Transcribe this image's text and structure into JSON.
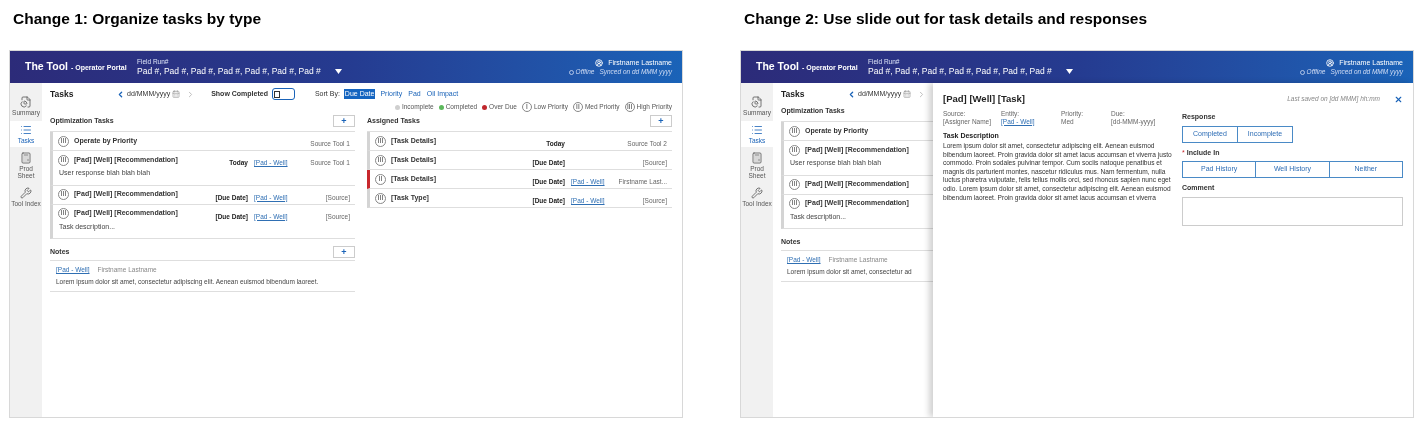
{
  "changes": [
    {
      "heading": "Change 1: Organize tasks by type",
      "header": {
        "brand": "The Tool",
        "subtitle": "- Operator Portal",
        "field_label": "Field Run#",
        "field_value": "Pad #, Pad #, Pad #, Pad #, Pad #, Pad #, Pad #",
        "user": "Firstname Lastname",
        "status": "Offline",
        "synced": "Synced on dd MMM yyyy"
      },
      "sidebar": [
        {
          "label": "Summary",
          "kind": "summary",
          "selected": false
        },
        {
          "label": "Tasks",
          "kind": "tasks",
          "selected": true
        },
        {
          "label": "Prod Sheet",
          "kind": "sheet",
          "selected": false
        },
        {
          "label": "Tool Index",
          "kind": "tools",
          "selected": false
        }
      ],
      "toolbar": {
        "title": "Tasks",
        "date": "dd/MMM/yyyy",
        "show_completed": {
          "label": "Show Completed",
          "on": false
        },
        "sort_label": "Sort By:",
        "sort_options": [
          {
            "label": "Due Date",
            "selected": true
          },
          {
            "label": "Priority",
            "selected": false
          },
          {
            "label": "Pad",
            "selected": false
          },
          {
            "label": "Oil Impact",
            "selected": false
          }
        ],
        "status_legend": [
          {
            "label": "Incomplete",
            "color": "#cfcfcf"
          },
          {
            "label": "Completed",
            "color": "#5cb85c"
          },
          {
            "label": "Over Due",
            "color": "#c0272d"
          }
        ],
        "priority_legend": [
          {
            "mark": "I",
            "label": "Low Priority"
          },
          {
            "mark": "II",
            "label": "Med Priority"
          },
          {
            "mark": "III",
            "label": "High Priority"
          }
        ]
      },
      "sections": [
        {
          "title": "Optimization Tasks",
          "add": "+",
          "tasks": [
            {
              "priority": "III",
              "title": "Operate by Priority",
              "source": "Source Tool 1",
              "overdue": false
            },
            {
              "priority": "III",
              "title": "[Pad] [Well] [Recommendation]",
              "due": "Today",
              "link": "[Pad - Well]",
              "source": "Source Tool 1",
              "detail": "User response blah blah blah",
              "overdue": false
            },
            {
              "priority": "III",
              "title": "[Pad] [Well] [Recommendation]",
              "due": "[Due Date]",
              "link": "[Pad - Well]",
              "source": "[Source]",
              "overdue": false
            },
            {
              "priority": "III",
              "title": "[Pad] [Well] [Recommendation]",
              "due": "[Due Date]",
              "link": "[Pad - Well]",
              "source": "[Source]",
              "detail": "Task description...",
              "overdue": false
            }
          ]
        },
        {
          "title": "Assigned Tasks",
          "add": "+",
          "tasks": [
            {
              "priority": "III",
              "title": "[Task Details]",
              "due": "Today",
              "source": "Source Tool 2",
              "overdue": false
            },
            {
              "priority": "III",
              "title": "[Task Details]",
              "due": "[Due Date]",
              "source": "[Source]",
              "overdue": false
            },
            {
              "priority": "II",
              "title": "[Task Details]",
              "due": "[Due Date]",
              "link": "[Pad - Well]",
              "source": "Firstname Last...",
              "overdue": true
            },
            {
              "priority": "III",
              "title": "[Task Type]",
              "due": "[Due Date]",
              "link": "[Pad - Well]",
              "source": "[Source]",
              "overdue": false
            }
          ]
        }
      ],
      "notes": {
        "title": "Notes",
        "add": "+",
        "items": [
          {
            "link": "[Pad - Well]",
            "author": "Firstname Lastname",
            "text": "Lorem ipsum dolor sit amet, consectetur adipiscing elit. Aenean euismod bibendum laoreet."
          }
        ]
      }
    },
    {
      "heading": "Change 2: Use slide out for task details and responses",
      "header": {
        "brand": "The Tool",
        "subtitle": "- Operator Portal",
        "field_label": "Field Run#",
        "field_value": "Pad #, Pad #, Pad #, Pad #, Pad #, Pad #, Pad #",
        "user": "Firstname Lastname",
        "status": "Offline",
        "synced": "Synced on dd MMM yyyy"
      },
      "sidebar": [
        {
          "label": "Summary",
          "kind": "summary",
          "selected": false
        },
        {
          "label": "Tasks",
          "kind": "tasks",
          "selected": true
        },
        {
          "label": "Prod Sheet",
          "kind": "sheet",
          "selected": false
        },
        {
          "label": "Tool Index",
          "kind": "tools",
          "selected": false
        }
      ],
      "toolbar": {
        "title": "Tasks",
        "date": "dd/MMM/yyyy"
      },
      "sections": [
        {
          "title": "Optimization Tasks",
          "tasks": [
            {
              "priority": "III",
              "title": "Operate by Priority",
              "overdue": false
            },
            {
              "priority": "III",
              "title": "[Pad] [Well] [Recommendation]",
              "detail": "User response blah blah blah",
              "overdue": false
            },
            {
              "priority": "III",
              "title": "[Pad] [Well] [Recommendation]",
              "overdue": false
            },
            {
              "priority": "III",
              "title": "[Pad] [Well] [Recommendation]",
              "detail": "Task description...",
              "overdue": false
            }
          ]
        }
      ],
      "notes": {
        "title": "Notes",
        "items": [
          {
            "link": "[Pad - Well]",
            "author": "Firstname Lastname",
            "text": "Lorem ipsum dolor sit amet, consectetur ad"
          }
        ]
      },
      "slideout": {
        "title": "[Pad] [Well] [Task]",
        "saved": "Last saved on [dd MMM] hh:mm",
        "fields": [
          {
            "label": "Source:",
            "value": "[Assigner Name]",
            "kind": "text"
          },
          {
            "label": "Entity:",
            "value": "[Pad - Well]",
            "kind": "link"
          },
          {
            "label": "Priority:",
            "value": "Med",
            "kind": "text"
          },
          {
            "label": "Due:",
            "value": "[dd-MMM-yyyy]",
            "kind": "text"
          }
        ],
        "description_title": "Task Description",
        "description": "Lorem ipsum dolor sit amet, consectetur adipiscing elit. Aenean euismod bibendum laoreet. Proin gravida dolor sit amet lacus accumsan et viverra justo commodo. Proin sodales pulvinar tempor. Cum sociis natoque penatibus et magnis dis parturient montes, nascetur ridiculus mus. Nam fermentum, nulla luctus pharetra vulputate, felis tellus mollis orci, sed rhoncus sapien nunc eget odio. Lorem ipsum dolor sit amet, consectetur adipiscing elit. Aenean euismod bibendum laoreet. Proin gravida dolor sit amet lacus accumsan et viverra",
        "response": {
          "label": "Response",
          "options": [
            {
              "label": "Completed",
              "selected": false
            },
            {
              "label": "Incomplete",
              "selected": false
            }
          ]
        },
        "include": {
          "required": "*",
          "label": "Include In",
          "options": [
            {
              "label": "Pad History",
              "selected": false
            },
            {
              "label": "Well History",
              "selected": false
            },
            {
              "label": "Neither",
              "selected": false
            }
          ]
        },
        "comment": {
          "label": "Comment"
        }
      }
    }
  ]
}
